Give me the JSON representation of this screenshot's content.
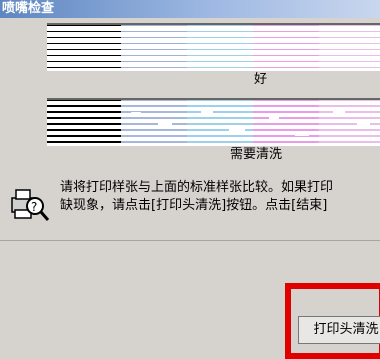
{
  "window": {
    "title": "喷嘴检查"
  },
  "samples": [
    {
      "label": "好"
    },
    {
      "label": "需要清洗"
    }
  ],
  "message": {
    "line1": "请将打印样张与上面的标准样张比较。如果打印",
    "line2": "缺现象，请点击[打印头清洗]按钮。点击[结束]"
  },
  "buttons": {
    "head_clean": "打印头清洗"
  },
  "colors": {
    "highlight": "#e00000",
    "swatches": [
      "#000000",
      "#9eb1d7",
      "#9fd0e9",
      "#ea9ce6",
      "#e8bfe8"
    ]
  },
  "icons": [
    "printer-help-icon"
  ]
}
